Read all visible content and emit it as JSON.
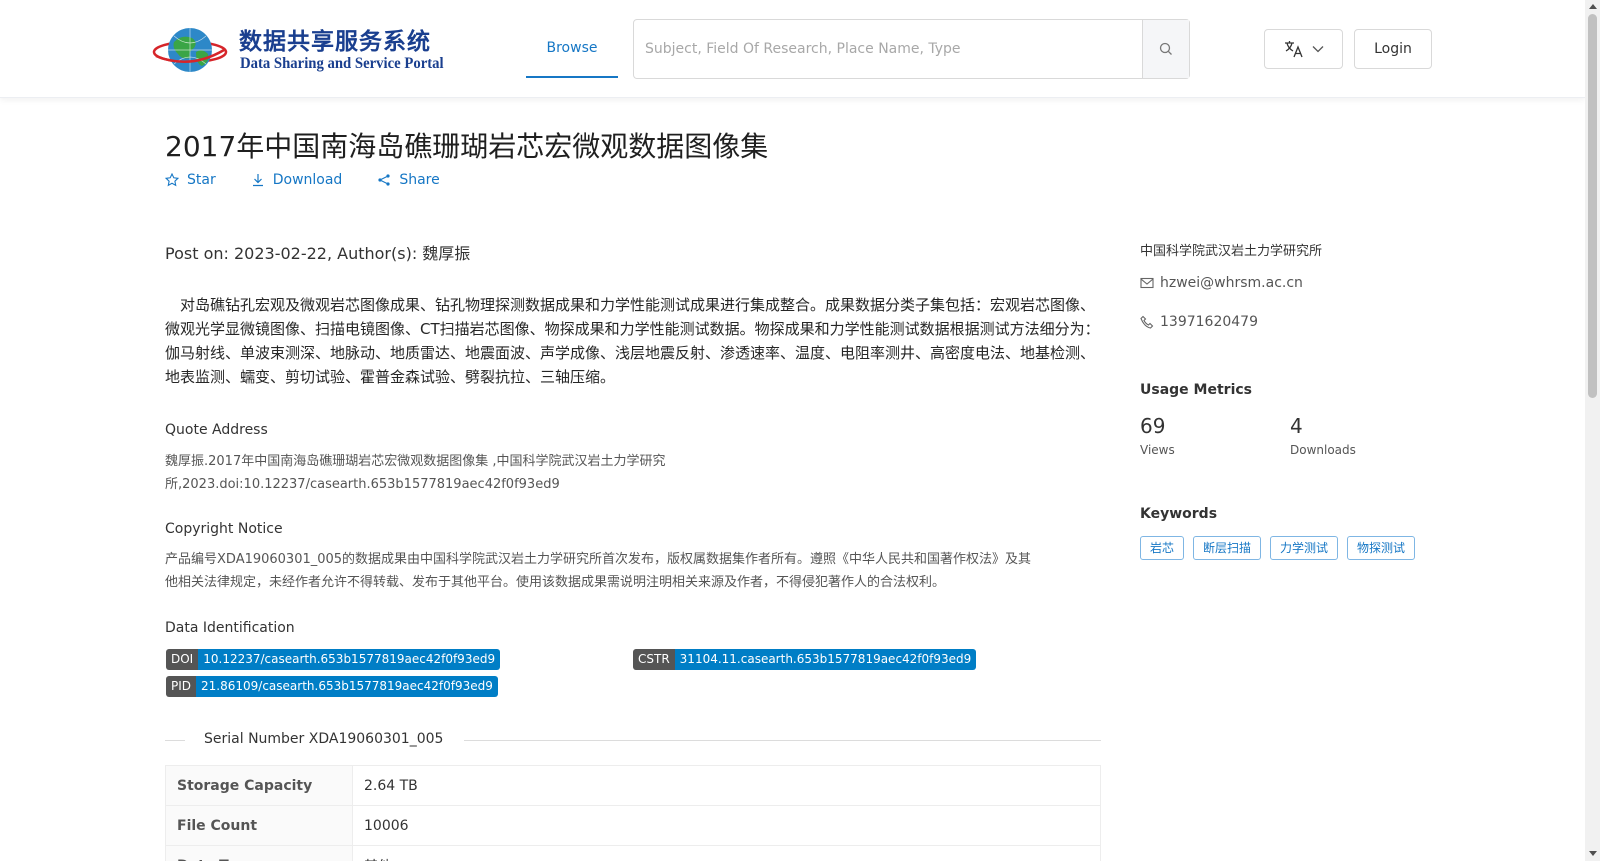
{
  "header": {
    "logo_zh": "数据共享服务系统",
    "logo_en": "Data Sharing and Service Portal",
    "nav_browse": "Browse",
    "search_placeholder": "Subject, Field Of Research, Place Name, Type",
    "login_label": "Login",
    "language_icon": "translate-icon"
  },
  "dataset": {
    "title": "2017年中国南海岛礁珊瑚岩芯宏微观数据图像集",
    "actions": {
      "star": "Star",
      "download": "Download",
      "share": "Share"
    },
    "meta": "Post on: 2023-02-22, Author(s): 魏厚振",
    "abstract": "对岛礁钻孔宏观及微观岩芯图像成果、钻孔物理探测数据成果和力学性能测试成果进行集成整合。成果数据分类子集包括：宏观岩芯图像、微观光学显微镜图像、扫描电镜图像、CT扫描岩芯图像、物探成果和力学性能测试数据。物探成果和力学性能测试数据根据测试方法细分为：伽马射线、单波束测深、地脉动、地质雷达、地震面波、声学成像、浅层地震反射、渗透速率、温度、电阻率测井、高密度电法、地基检测、地表监测、蠕变、剪切试验、霍普金森试验、劈裂抗拉、三轴压缩。",
    "quote": {
      "label": "Quote Address",
      "line1": "魏厚振.2017年中国南海岛礁珊瑚岩芯宏微观数据图像集 ,中国科学院武汉岩土力学研究",
      "line2": "所,2023.doi:10.12237/casearth.653b1577819aec42f0f93ed9"
    },
    "copyright": {
      "label": "Copyright Notice",
      "line1": "产品编号XDA19060301_005的数据成果由中国科学院武汉岩土力学研究所首次发布，版权属数据集作者所有。遵照《中华人民共和国著作权法》及其",
      "line2": "他相关法律规定，未经作者允许不得转载、发布于其他平台。使用该数据成果需说明注明相关来源及作者，不得侵犯著作人的合法权利。"
    },
    "identification": {
      "label": "Data Identification",
      "doi_key": "DOI",
      "doi_value": "10.12237/casearth.653b1577819aec42f0f93ed9",
      "cstr_key": "CSTR",
      "cstr_value": "31104.11.casearth.653b1577819aec42f0f93ed9",
      "pid_key": "PID",
      "pid_value": "21.86109/casearth.653b1577819aec42f0f93ed9"
    },
    "serial_number": "Serial Number XDA19060301_005",
    "info_rows": [
      {
        "label": "Storage Capacity",
        "value": "2.64 TB"
      },
      {
        "label": "File Count",
        "value": "10006"
      },
      {
        "label": "Data Type",
        "value": "其他"
      }
    ]
  },
  "sidebar": {
    "organization": "中国科学院武汉岩土力学研究所",
    "email": "hzwei@whrsm.ac.cn",
    "phone": "13971620479",
    "usage_heading": "Usage Metrics",
    "views_value": "69",
    "views_label": "Views",
    "downloads_value": "4",
    "downloads_label": "Downloads",
    "keywords_heading": "Keywords",
    "keywords": [
      "岩芯",
      "断层扫描",
      "力学测试",
      "物探测试"
    ]
  },
  "colors": {
    "accent": "#1677c5",
    "badge_key": "#555555",
    "badge_value": "#007ec6"
  }
}
